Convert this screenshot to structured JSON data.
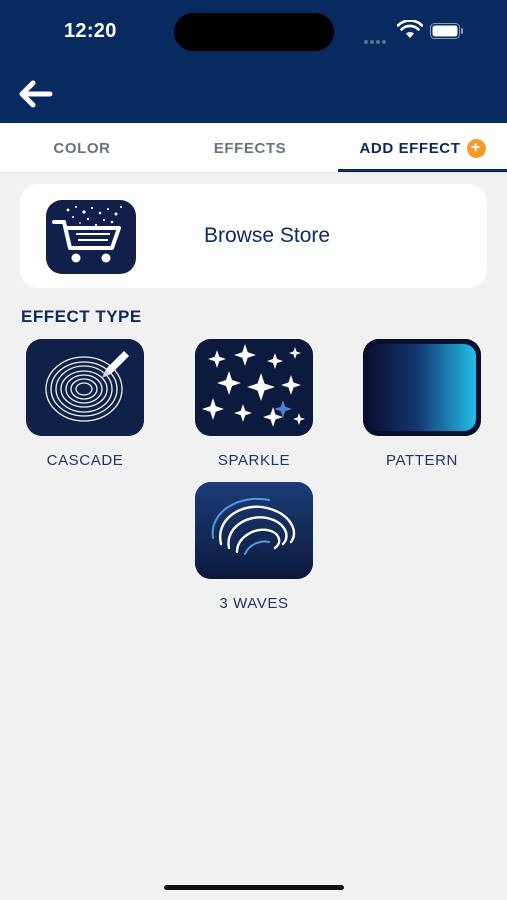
{
  "status_bar": {
    "time": "12:20"
  },
  "nav": {
    "back_icon": "arrow-left-icon"
  },
  "tabs": [
    {
      "label": "COLOR",
      "active": false
    },
    {
      "label": "EFFECTS",
      "active": false
    },
    {
      "label": "ADD EFFECT",
      "active": true,
      "icon": "plus-circle-icon"
    }
  ],
  "store": {
    "label": "Browse Store",
    "icon": "shopping-cart-icon"
  },
  "effect_type": {
    "title": "EFFECT TYPE",
    "items": [
      {
        "label": "CASCADE",
        "icon": "cascade-swirl-icon"
      },
      {
        "label": "SPARKLE",
        "icon": "sparkle-stars-icon"
      },
      {
        "label": "PATTERN",
        "icon": "pattern-gradient-icon"
      },
      {
        "label": "3 WAVES",
        "icon": "waves-icon"
      }
    ]
  },
  "colors": {
    "header_bg": "#082a5e",
    "accent": "#0d2a5c",
    "badge": "#f39a2b",
    "background": "#f1f1f1"
  }
}
